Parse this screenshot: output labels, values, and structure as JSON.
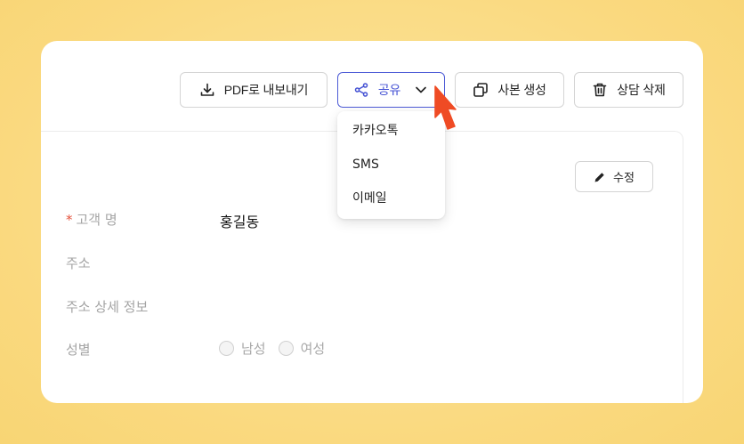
{
  "toolbar": {
    "pdf_label": "PDF로 내보내기",
    "share_label": "공유",
    "copy_label": "사본 생성",
    "delete_label": "상담 삭제"
  },
  "share_menu": {
    "items": [
      {
        "label": "카카오톡"
      },
      {
        "label": "SMS"
      },
      {
        "label": "이메일"
      }
    ]
  },
  "detail": {
    "edit_label": "수정",
    "required_mark": "*",
    "fields": {
      "customer_name": {
        "label": "고객 명",
        "value": "홍길동"
      },
      "address": {
        "label": "주소"
      },
      "address_detail": {
        "label": "주소 상세 정보"
      },
      "gender": {
        "label": "성별",
        "options": [
          "남성",
          "여성"
        ]
      }
    }
  },
  "colors": {
    "accent": "#4552d4",
    "required": "#e5533d",
    "cursor": "#ef4b24",
    "background": "#fad97f"
  }
}
